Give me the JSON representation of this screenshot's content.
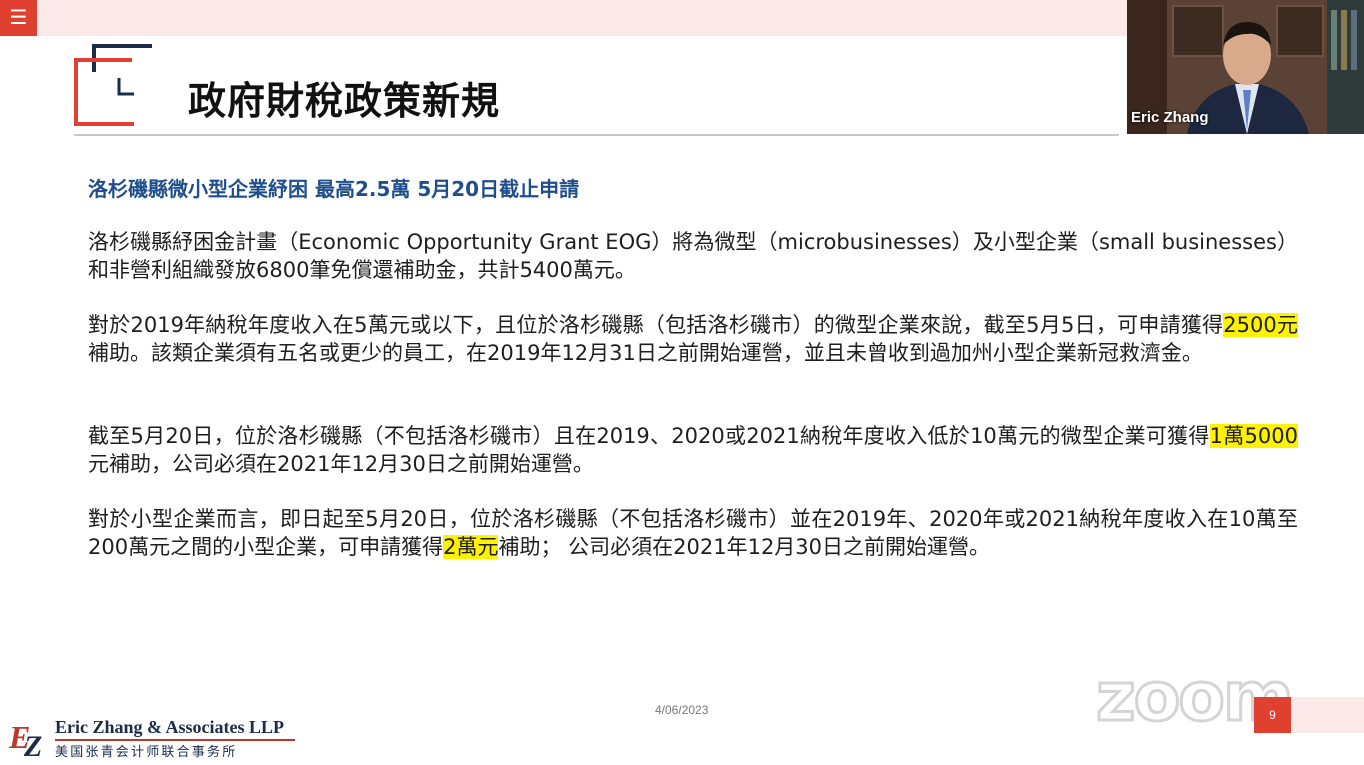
{
  "toolbar": {
    "menu_icon": "☰"
  },
  "slide": {
    "title": "政府財稅政策新規",
    "headline": "洛杉磯縣微小型企業紓困 最高2.5萬 5月20日截止申請",
    "p1": "洛杉磯縣紓困金計畫（Economic Opportunity Grant EOG）將為微型（microbusinesses）及小型企業（small businesses）和非營利組織發放6800筆免償還補助金，共計5400萬元。",
    "p2_a": "對於2019年納稅年度收入在5萬元或以下，且位於洛杉磯縣（包括洛杉磯市）的微型企業來說，截至5月5日，可申請獲得",
    "p2_hl": "2500元",
    "p2_b": "補助。該類企業須有五名或更少的員工，在2019年12月31日之前開始運營，並且未曾收到過加州小型企業新冠救濟金。",
    "p3_a": "截至5月20日，位於洛杉磯縣（不包括洛杉磯市）且在2019、2020或2021納稅年度收入低於10萬元的微型企業可獲得",
    "p3_hl": "1萬5000",
    "p3_b": "元補助，公司必須在2021年12月30日之前開始運營。",
    "p4_a": "對於小型企業而言，即日起至5月20日，位於洛杉磯縣（不包括洛杉磯市）並在2019年、2020年或2021納稅年度收入在10萬至200萬元之間的小型企業，可申請獲得",
    "p4_hl": "2萬元",
    "p4_b": "補助； 公司必須在2021年12月30日之前開始運營。",
    "date": "4/06/2023",
    "page_number": "9"
  },
  "video": {
    "participant_name": "Eric Zhang"
  },
  "firm": {
    "name": "Eric Zhang & Associates LLP",
    "chinese_name": "美国张青会计师联合事务所",
    "logo_text": "EZ"
  },
  "watermark": {
    "text": "zoom"
  },
  "colors": {
    "accent": "#e0402f",
    "navy": "#1c2b4a",
    "headline_blue": "#1f4e8c",
    "highlight": "#fff200"
  }
}
